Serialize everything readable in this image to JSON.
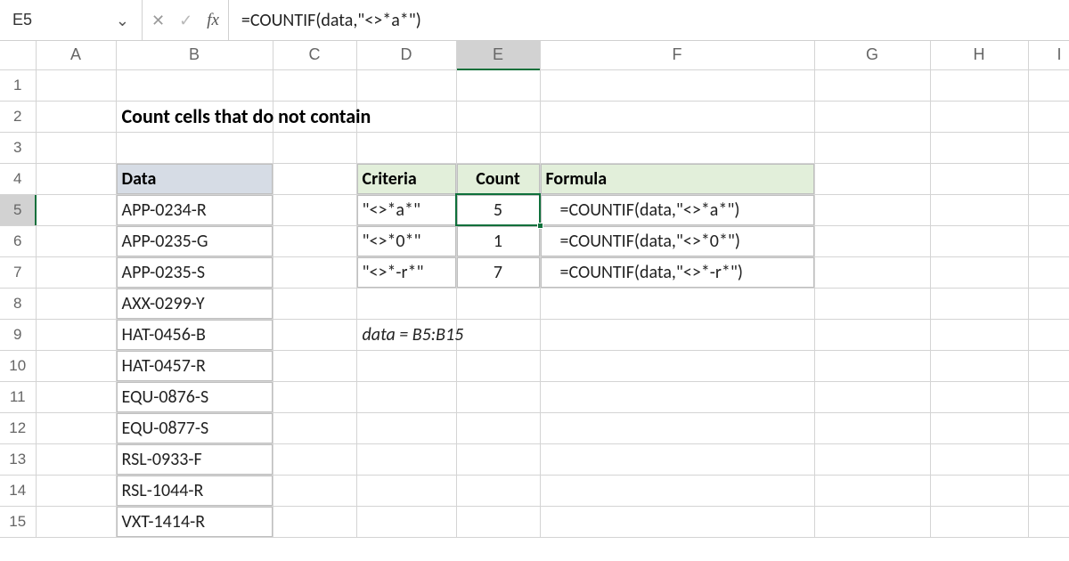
{
  "name_box": "E5",
  "formula_bar": "=COUNTIF(data,\"<>*a*\")",
  "columns": [
    "A",
    "B",
    "C",
    "D",
    "E",
    "F",
    "G",
    "H",
    "I"
  ],
  "selected_col": "E",
  "selected_row": 5,
  "title": "Count cells that do not contain",
  "data_table": {
    "header": "Data",
    "rows": [
      "APP-0234-R",
      "APP-0235-G",
      "APP-0235-S",
      "AXX-0299-Y",
      "HAT-0456-B",
      "HAT-0457-R",
      "EQU-0876-S",
      "EQU-0877-S",
      "RSL-0933-F",
      "RSL-1044-R",
      "VXT-1414-R"
    ]
  },
  "result_table": {
    "headers": {
      "criteria": "Criteria",
      "count": "Count",
      "formula": "Formula"
    },
    "rows": [
      {
        "criteria": "\"<>*a*\"",
        "count": "5",
        "formula": "=COUNTIF(data,\"<>*a*\")"
      },
      {
        "criteria": "\"<>*0*\"",
        "count": "1",
        "formula": "=COUNTIF(data,\"<>*0*\")"
      },
      {
        "criteria": "\"<>*-r*\"",
        "count": "7",
        "formula": "=COUNTIF(data,\"<>*-r*\")"
      }
    ]
  },
  "note": "data = B5:B15",
  "fx_label": "fx",
  "cancel_glyph": "✕",
  "confirm_glyph": "✓",
  "chevron_glyph": "⌄"
}
